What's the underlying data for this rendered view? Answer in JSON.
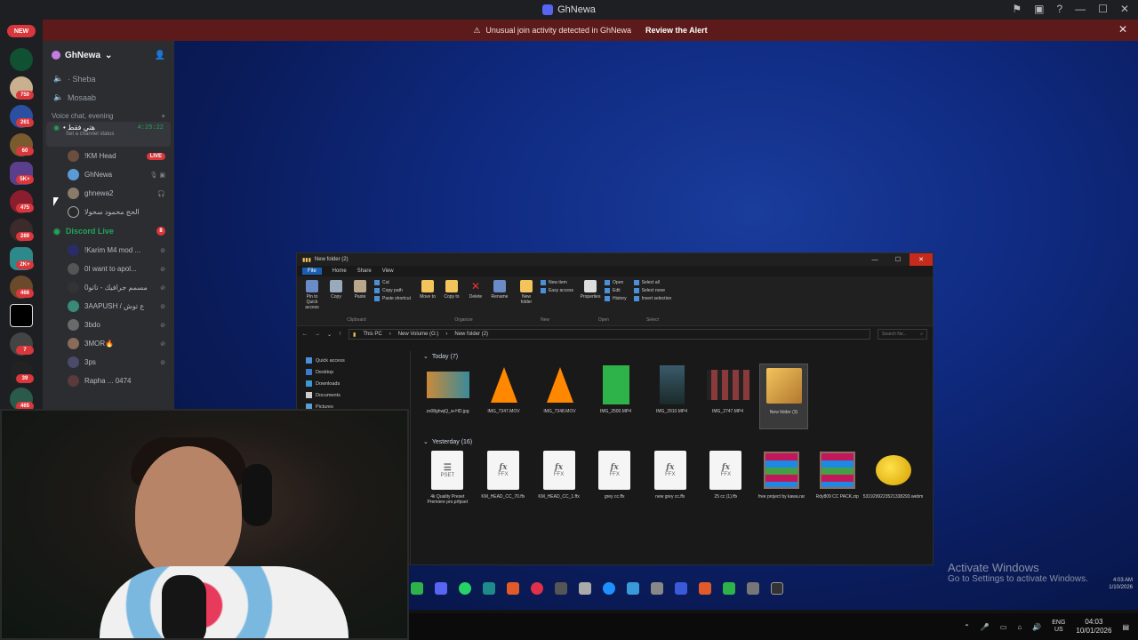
{
  "window": {
    "title": "GhNewa",
    "alert_text": "Unusual join activity detected in GhNewa",
    "alert_link": "Review the Alert"
  },
  "server_rail": {
    "new_badge": "NEW",
    "badges": [
      "750",
      "261",
      "60",
      "5K+",
      "475",
      "289",
      "2K+",
      "466",
      "7",
      "39",
      "465"
    ]
  },
  "sidebar": {
    "server_name": "GhNewa",
    "channels": [
      {
        "name": "· Sheba"
      },
      {
        "name": "Mosaab"
      }
    ],
    "voice_category": "Voice chat, evening",
    "voice_channel": {
      "name": "• هتي فقط",
      "time": "4:25:22",
      "status": "Set a channel status"
    },
    "members": [
      {
        "name": "!KM Head",
        "badge": "LIVE"
      },
      {
        "name": "GhNewa"
      },
      {
        "name": "ghnewa2"
      },
      {
        "name": "الحج محمود سحولا"
      }
    ],
    "discord_live": {
      "name": "Discord Live",
      "count": "8"
    },
    "live_members": [
      {
        "name": "!Karim M4 mod ..."
      },
      {
        "name": "0I want to apol..."
      },
      {
        "name": "مسمم جرافيك - تاتو0"
      },
      {
        "name": "3AAPUSH / ع توش"
      },
      {
        "name": "3bdo"
      },
      {
        "name": "3MOR🔥"
      },
      {
        "name": "3ps"
      },
      {
        "name": "Rapha ... 0474"
      }
    ]
  },
  "explorer": {
    "title": "New folder (2)",
    "tabs": [
      "File",
      "Home",
      "Share",
      "View"
    ],
    "ribbon": {
      "pin": "Pin to Quick access",
      "copy": "Copy",
      "paste": "Paste",
      "cut": "Cut",
      "copy_path": "Copy path",
      "paste_shortcut": "Paste shortcut",
      "clipboard": "Clipboard",
      "move_to": "Move to",
      "copy_to": "Copy to",
      "delete": "Delete",
      "rename": "Rename",
      "organize": "Organize",
      "new_folder": "New folder",
      "new_item": "New item",
      "easy_access": "Easy access",
      "new": "New",
      "properties": "Properties",
      "open": "Open",
      "edit": "Edit",
      "history": "History",
      "open_group": "Open",
      "select_all": "Select all",
      "select_none": "Select none",
      "invert_selection": "Invert selection",
      "select": "Select"
    },
    "breadcrumb": [
      "This PC",
      "New Volume (G:)",
      "New folder (2)"
    ],
    "search_placeholder": "Search Ne...",
    "nav": [
      "Quick access",
      "Desktop",
      "Downloads",
      "Documents",
      "Pictures"
    ],
    "groups": [
      {
        "label": "Today (7)",
        "files": [
          {
            "name": "zs08ghwjQ_w-HD.jpg",
            "type": "image"
          },
          {
            "name": "IMG_7347.MOV",
            "type": "vlc"
          },
          {
            "name": "IMG_7348.MOV",
            "type": "vlc"
          },
          {
            "name": "IMG_2500.MP4",
            "type": "green"
          },
          {
            "name": "IMG_2910.MP4",
            "type": "video"
          },
          {
            "name": "IMG_2747.MP4",
            "type": "film"
          },
          {
            "name": "New folder (3)",
            "type": "folder"
          }
        ]
      },
      {
        "label": "Yesterday (16)",
        "files": [
          {
            "name": "4k Quality Preset Premiere pro.prfpset",
            "type": "pset"
          },
          {
            "name": "KM_HEAD_CC_70.ffx",
            "type": "ffx"
          },
          {
            "name": "KM_HEAD_CC_1.ffx",
            "type": "ffx"
          },
          {
            "name": "grey cc.ffx",
            "type": "ffx"
          },
          {
            "name": "new grey cc.ffx",
            "type": "ffx"
          },
          {
            "name": "25 cc (1).ffx",
            "type": "ffx"
          },
          {
            "name": "free project by kawa.rar",
            "type": "rar"
          },
          {
            "name": "Rdy809 CC PACK.zip",
            "type": "rar"
          },
          {
            "name": "5319299223521338293.webm",
            "type": "webm"
          }
        ]
      }
    ],
    "ffx_label": "FFX",
    "pset_label": "PSET"
  },
  "inner_clock": {
    "time": "4:03 AM",
    "date": "1/10/2026"
  },
  "activation": {
    "title": "Activate Windows",
    "subtitle": "Go to Settings to activate Windows."
  },
  "system_tray": {
    "lang1": "ENG",
    "lang2": "US",
    "time": "04:03",
    "date": "10/01/2026"
  }
}
